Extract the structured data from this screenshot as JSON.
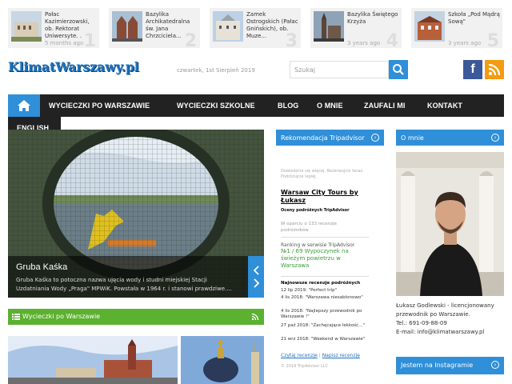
{
  "top_posts": [
    {
      "title": "Pałac Kazimierzowski, ob. Rektorat Uniwersyte. .",
      "ago": "5 months ago",
      "num": "1"
    },
    {
      "title": "Bazylika Archikatedralna św. Jana Chrzciciela...",
      "ago": "",
      "num": "2"
    },
    {
      "title": "Zamek Ostrogskich (Pałac Gnińskich), ob. Muze...",
      "ago": "",
      "num": "3"
    },
    {
      "title": "Bazylika Świętego Krzyża",
      "ago": "3 years ago",
      "num": "4"
    },
    {
      "title": "Szkoła „Pod Mądrą Sową\"",
      "ago": "3 years ago",
      "num": "5"
    }
  ],
  "header": {
    "logo": "KlimatWarszawy.pl",
    "date": "czwartek, 1st Sierpień 2019",
    "search_placeholder": "Szukaj",
    "fb_label": "f"
  },
  "nav": {
    "items": [
      "WYCIECZKI PO WARSZAWIE",
      "WYCIECZKI SZKOLNE",
      "BLOG",
      "O MNIE",
      "ZAUFALI MI",
      "KONTAKT"
    ],
    "english": "ENGLISH"
  },
  "slider": {
    "title": "Gruba Kaśka",
    "text": "Gruba Kaśka to potoczna nazwa ujęcia wody i studni miejskiej Stacji Uzdatniania Wody „Praga\" MPWiK. Powstała w 1964 r. i stanowi prawdziwe...."
  },
  "section": {
    "title": "Wycieczki po Warszawie"
  },
  "tripadvisor": {
    "header": "Rekomendacja Tripadvisor",
    "small": "Dowiedzcie się więcej. Rezerwujcie teraz. Podróżujcie lepiej.",
    "title": "Warsaw City Tours by Łukasz",
    "sub": "Oceny podróżnych TripAdvisor",
    "count": "W oparciu o 133 recenzje podróżników",
    "rank_label": "Ranking w serwisie TripAdvisor",
    "rank": "№1 / 69 Wypoczynek na świeżym powietrzu w Warszawa",
    "new_label": "Najnowsze recenzje podróżnych",
    "reviews": [
      "12 lip 2019: \"Perfect trip\"",
      "4 lis 2018: \"Warszawa niesablonowo\"",
      "4 lis 2018: \"Najlepszy przewodnik po Warszawie !\"",
      "27 paź 2018: \"Zachęcające lekkość...\"",
      "21 wrz 2018: \"Weekend w Warszawie\""
    ],
    "read_link": "Czytaj recenzje",
    "write_link": "Napisz recenzję",
    "copyright": "© 2019 TripAdvisor LLC"
  },
  "about": {
    "header": "O mnie",
    "line1": "Łukasz Godlewski - licencjonowany przewodnik po Warszawie.",
    "phone": "Tel.: 691-09-88-09",
    "email": "E-mail: info@klimatwarszawy.pl"
  },
  "instagram": {
    "header": "Jestem na Instagramie"
  },
  "colors": {
    "accent": "#2f8fd8",
    "nav_bg": "#222222",
    "green": "#5cb130"
  }
}
